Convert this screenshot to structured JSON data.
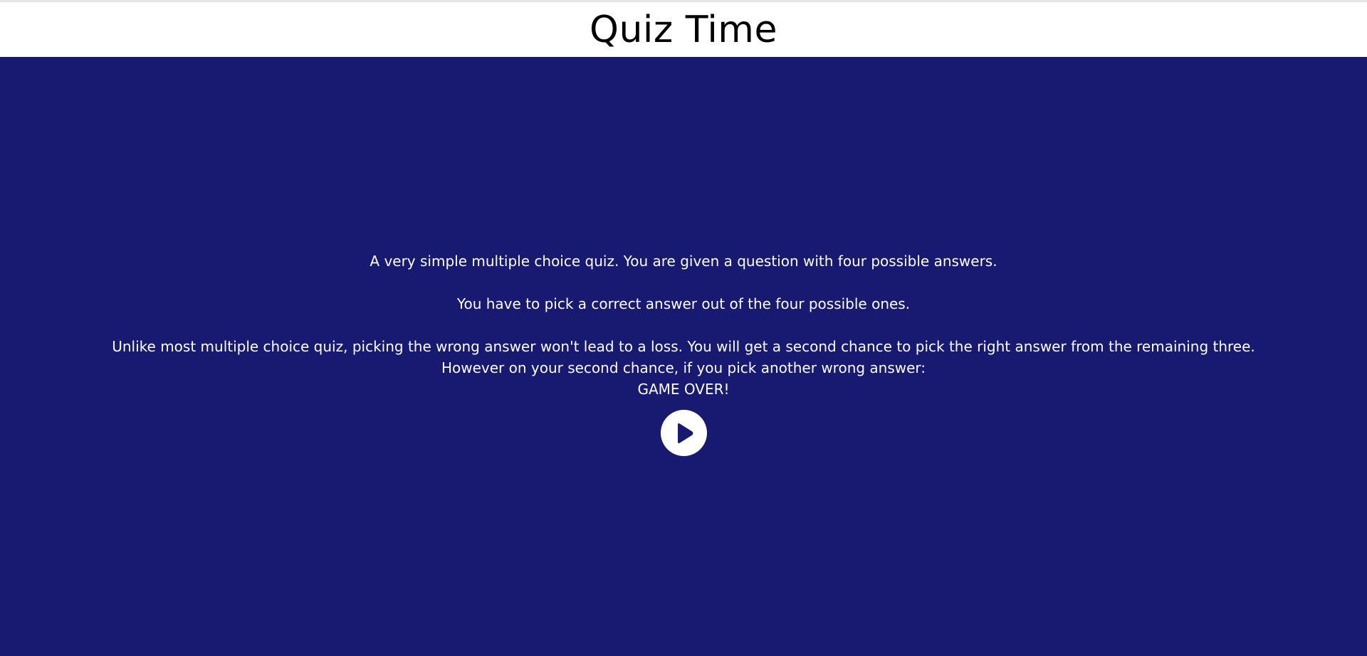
{
  "header": {
    "title": "Quiz Time"
  },
  "intro": {
    "line1": "A very simple multiple choice quiz. You are given a question with four possible answers.",
    "line2": "You have to pick a correct answer out of the four possible ones.",
    "line3": "Unlike most multiple choice quiz, picking the wrong answer won't lead to a loss. You will get a second chance to pick the right answer from the remaining three.",
    "line4": "However on your second chance, if you pick another wrong answer:",
    "line5": "GAME OVER!"
  },
  "play_button": {
    "icon": "play-icon"
  },
  "colors": {
    "background": "#181970",
    "header_background": "#ffffff",
    "text": "#ffffff",
    "title": "#000000"
  }
}
